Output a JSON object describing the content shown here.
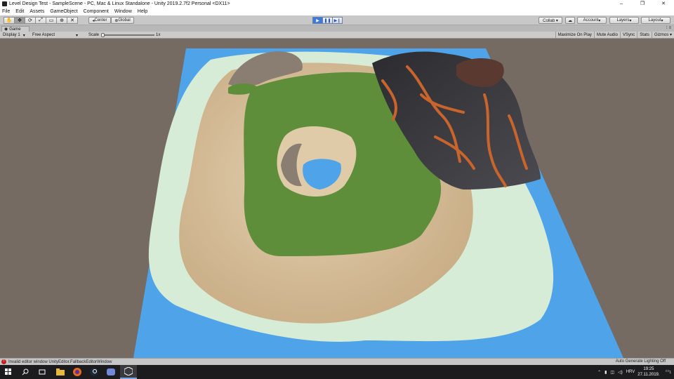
{
  "window": {
    "title": "Level Design Test - SampleScene - PC, Mac & Linux Standalone - Unity 2019.2.7f2 Personal <DX11>",
    "minimize": "–",
    "maximize": "❐",
    "close": "✕"
  },
  "menu": [
    "File",
    "Edit",
    "Assets",
    "GameObject",
    "Component",
    "Window",
    "Help"
  ],
  "toolbar": {
    "pivot": "Center",
    "space": "Global",
    "collab": "Collab ▾",
    "account": "Account",
    "layers": "Layers",
    "layout": "Layout"
  },
  "tab": {
    "label": "Game",
    "menu": "⁝ ≡"
  },
  "game_bar": {
    "display": "Display 1",
    "aspect": "Free Aspect",
    "scale_label": "Scale",
    "scale_value": "1x",
    "maximize": "Maximize On Play",
    "mute": "Mute Audio",
    "vsync": "VSync",
    "stats": "Stats",
    "gizmos": "Gizmos ▾"
  },
  "status": {
    "message": "Invalid editor window UnityEditor.FallbackEditorWindow",
    "right": "Auto Generate Lighting Off"
  },
  "taskbar": {
    "lang": "HRV",
    "time": "19:25",
    "date": "27.11.2019.",
    "notif": "1"
  },
  "colors": {
    "ocean": "#4fa3e8",
    "shallow": "#d6ecd6",
    "sand": "#dcc4a0",
    "grass": "#5e8e3a",
    "rock": "#8a7e72",
    "volcano": "#3c3c40",
    "lava": "#c8642c",
    "background": "#756b62"
  }
}
